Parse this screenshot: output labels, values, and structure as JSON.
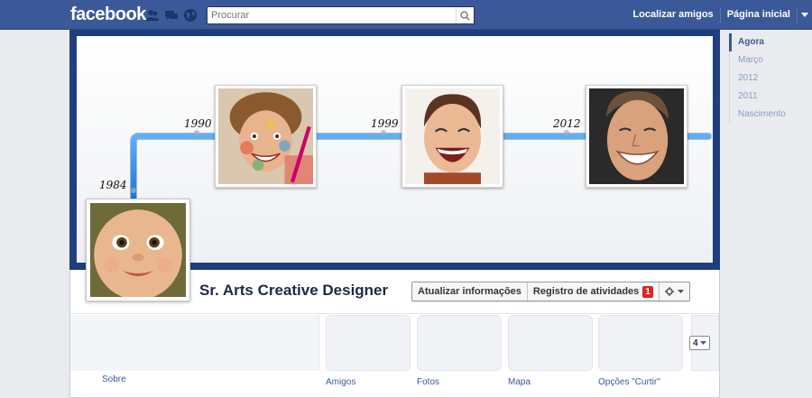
{
  "topbar": {
    "logo": "facebook",
    "search_placeholder": "Procurar",
    "find_friends": "Localizar amigos",
    "home": "Página inicial"
  },
  "colors": {
    "brand": "#3b5998",
    "cover_frame": "#1f3f7c",
    "timeline_line": "#1e88e5",
    "badge": "#e02424"
  },
  "cover": {
    "years": [
      "1984",
      "1990",
      "1999",
      "2012"
    ]
  },
  "profile": {
    "name": "Sr. Arts Creative Designer"
  },
  "actions": {
    "update_info": "Atualizar informações",
    "activity_log": "Registro de atividades",
    "activity_count": "1"
  },
  "sections": {
    "about": "Sobre",
    "friends": "Amigos",
    "photos": "Fotos",
    "map": "Mapa",
    "likes": "Opções \"Curtir\"",
    "more_count": "4"
  },
  "scrubber": {
    "items": [
      "Agora",
      "Março",
      "2012",
      "2011",
      "Nascimento"
    ]
  }
}
